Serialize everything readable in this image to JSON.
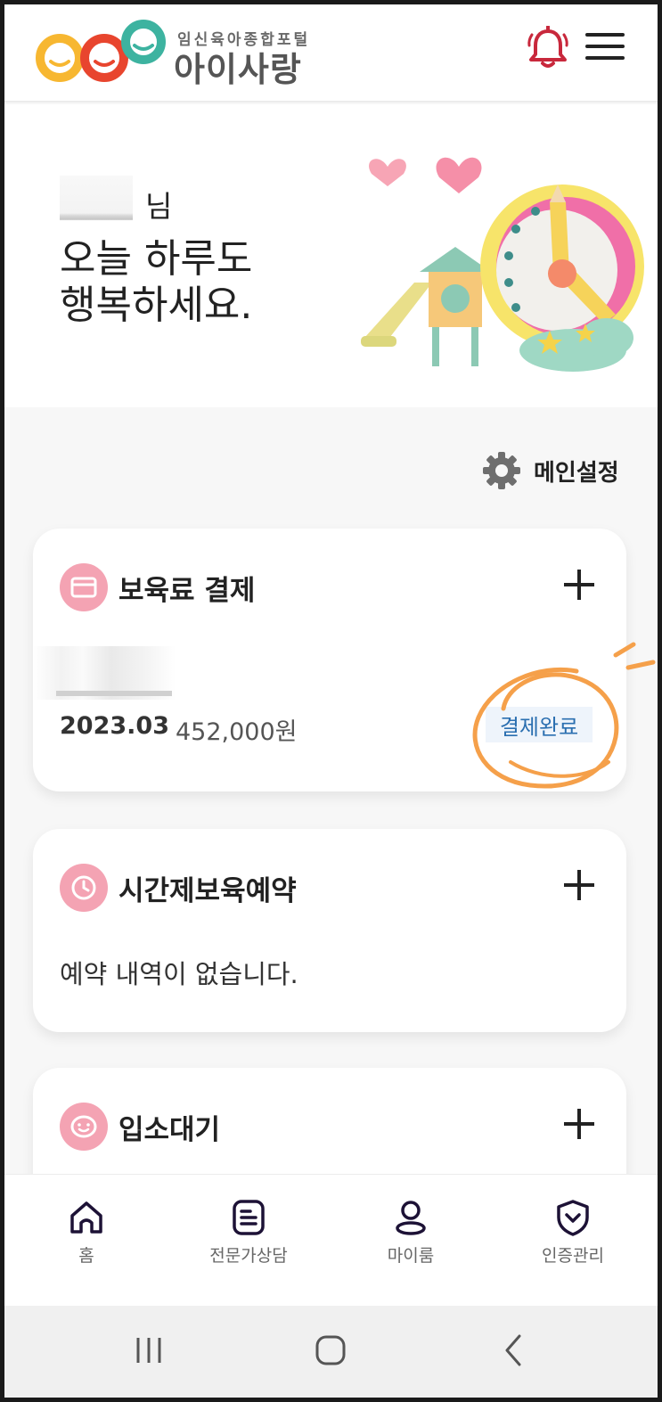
{
  "header": {
    "logo_sub": "임신육아종합포털",
    "logo_title": "아이사랑",
    "bell_icon": "bell-icon",
    "menu_icon": "hamburger-menu-icon",
    "bell_color": "#c8283c"
  },
  "hero": {
    "name_suffix": "님",
    "greeting_line1": "오늘 하루도",
    "greeting_line2": "행복하세요."
  },
  "main_settings": {
    "icon": "gear-icon",
    "label": "메인설정"
  },
  "cards": {
    "payment": {
      "icon": "card-icon",
      "title": "보육료 결제",
      "period": "2023.03",
      "amount": "452,000원",
      "status": "결제완료"
    },
    "reservation": {
      "icon": "clock-icon",
      "title": "시간제보육예약",
      "empty_message": "예약 내역이 없습니다."
    },
    "waitlist": {
      "icon": "baby-face-icon",
      "title": "입소대기"
    }
  },
  "bottom_nav": [
    {
      "icon": "home-icon",
      "label": "홈"
    },
    {
      "icon": "document-icon",
      "label": "전문가상담"
    },
    {
      "icon": "person-icon",
      "label": "마이룸"
    },
    {
      "icon": "shield-icon",
      "label": "인증관리"
    }
  ],
  "system_nav": {
    "recent_icon": "recent-apps-icon",
    "home_icon": "home-button-icon",
    "back_icon": "back-icon"
  },
  "colors": {
    "accent_pink": "#f4a3b3",
    "status_blue": "#2b6fb0",
    "annotation_orange": "#f5a04a"
  }
}
